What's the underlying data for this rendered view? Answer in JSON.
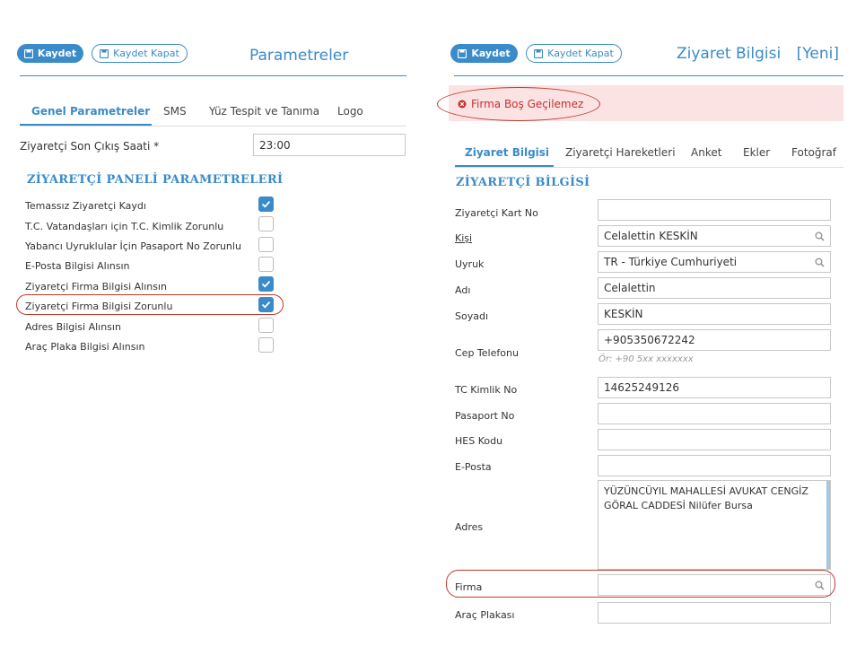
{
  "left": {
    "save_label": "Kaydet",
    "save_close_label": "Kaydet Kapat",
    "title": "Parametreler",
    "tabs": [
      {
        "label": "Genel Parametreler",
        "active": true
      },
      {
        "label": "SMS",
        "active": false
      },
      {
        "label": "Yüz Tespit ve Tanıma",
        "active": false
      },
      {
        "label": "Logo",
        "active": false
      }
    ],
    "checkout_label": "Ziyaretçi Son Çıkış Saati *",
    "checkout_value": "23:00",
    "section_title": "ZİYARETÇİ PANELİ PARAMETRELERİ",
    "params": [
      {
        "label": "Temassız Ziyaretçi Kaydı",
        "checked": true
      },
      {
        "label": "T.C. Vatandaşları için T.C. Kimlik Zorunlu",
        "checked": false
      },
      {
        "label": "Yabancı Uyruklular İçin Pasaport No Zorunlu",
        "checked": false
      },
      {
        "label": "E-Posta Bilgisi Alınsın",
        "checked": false
      },
      {
        "label": "Ziyaretçi Firma Bilgisi Alınsın",
        "checked": true
      },
      {
        "label": "Ziyaretçi Firma Bilgisi Zorunlu",
        "checked": true
      },
      {
        "label": "Adres Bilgisi Alınsın",
        "checked": false
      },
      {
        "label": "Araç Plaka Bilgisi Alınsın",
        "checked": false
      }
    ]
  },
  "right": {
    "save_label": "Kaydet",
    "save_close_label": "Kaydet Kapat",
    "title": "Ziyaret Bilgisi",
    "title_suffix": "[Yeni]",
    "error_message": "Firma Boş Geçilemez",
    "tabs": [
      {
        "label": "Ziyaret Bilgisi",
        "active": true
      },
      {
        "label": "Ziyaretçi Hareketleri",
        "active": false
      },
      {
        "label": "Anket",
        "active": false
      },
      {
        "label": "Ekler",
        "active": false
      },
      {
        "label": "Fotoğraf",
        "active": false
      }
    ],
    "section_title": "ZİYARETÇİ BİLGİSİ",
    "fields": {
      "card_no": {
        "label": "Ziyaretçi Kart No",
        "value": ""
      },
      "person": {
        "label": "Kişi",
        "value": "Celalettin KESKİN"
      },
      "nationality": {
        "label": "Uyruk",
        "value": "TR - Türkiye Cumhuriyeti"
      },
      "first_name": {
        "label": "Adı",
        "value": "Celalettin"
      },
      "last_name": {
        "label": "Soyadı",
        "value": "KESKİN"
      },
      "mobile": {
        "label": "Cep Telefonu",
        "value": "+905350672242",
        "hint": "Ör: +90 5xx xxxxxxx"
      },
      "tc_no": {
        "label": "TC Kimlik No",
        "value": "14625249126"
      },
      "passport": {
        "label": "Pasaport No",
        "value": ""
      },
      "hes": {
        "label": "HES Kodu",
        "value": ""
      },
      "email": {
        "label": "E-Posta",
        "value": ""
      },
      "address": {
        "label": "Adres",
        "value": "YÜZÜNCÜYIL MAHALLESİ AVUKAT CENGİZ GÖRAL CADDESİ Nilüfer Bursa"
      },
      "company": {
        "label": "Firma",
        "value": ""
      },
      "plate": {
        "label": "Araç Plakası",
        "value": ""
      }
    }
  },
  "colors": {
    "accent": "#3a8bc8",
    "error": "#c9302c",
    "error_bg": "#fbe3e4"
  }
}
